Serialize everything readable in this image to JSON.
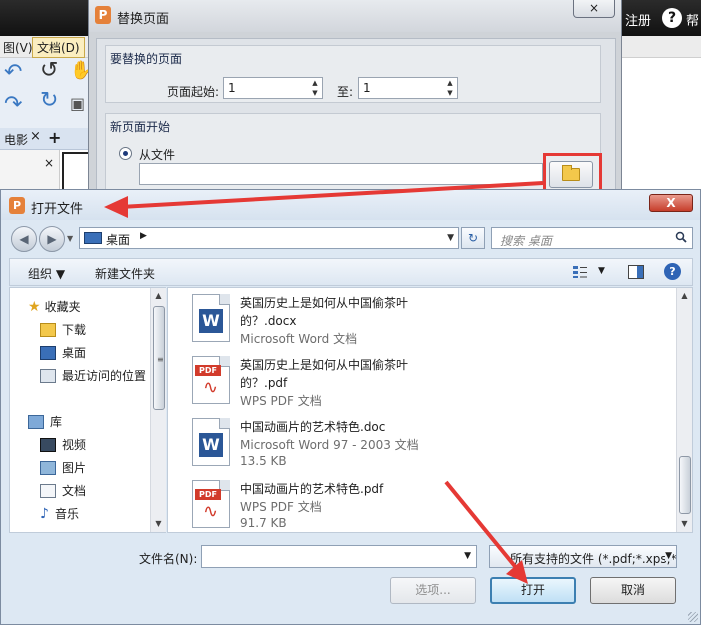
{
  "app": {
    "register": "注册",
    "help": "帮",
    "menu_view": "图(V)",
    "menu_doc": "文档(D)",
    "tab_label": "电影"
  },
  "replace_dialog": {
    "title": "替换页面",
    "close": "×",
    "group1_title": "要替换的页面",
    "page_start_label": "页面起始:",
    "page_start_value": "1",
    "to_label": "至:",
    "to_value": "1",
    "group2_title": "新页面开始",
    "from_file_label": "从文件",
    "file_path": ""
  },
  "open_dialog": {
    "title": "打开文件",
    "close": "X",
    "address": "桌面",
    "search_placeholder": "搜索 桌面",
    "toolbar": {
      "organize": "组织",
      "new_folder": "新建文件夹"
    },
    "nav": [
      {
        "label": "收藏夹",
        "icon": "star-icon"
      },
      {
        "label": "下载",
        "icon": "download-folder-icon"
      },
      {
        "label": "桌面",
        "icon": "desktop-icon"
      },
      {
        "label": "最近访问的位置",
        "icon": "recent-places-icon"
      },
      {
        "label": "库",
        "icon": "library-icon"
      },
      {
        "label": "视频",
        "icon": "video-icon"
      },
      {
        "label": "图片",
        "icon": "pictures-icon"
      },
      {
        "label": "文档",
        "icon": "documents-icon"
      },
      {
        "label": "音乐",
        "icon": "music-icon"
      }
    ],
    "files": [
      {
        "type": "word",
        "line1": "英国历史上是如何从中国偷茶叶",
        "line2": "的？.docx",
        "line3": "Microsoft Word 文档"
      },
      {
        "type": "pdf",
        "line1": "英国历史上是如何从中国偷茶叶",
        "line2": "的？.pdf",
        "line3": "WPS PDF 文档"
      },
      {
        "type": "word",
        "line1": "中国动画片的艺术特色.doc",
        "line2": "Microsoft Word 97 - 2003 文档",
        "line3": "13.5 KB"
      },
      {
        "type": "pdf",
        "line1": "中国动画片的艺术特色.pdf",
        "line2": "WPS PDF 文档",
        "line3": "91.7 KB"
      }
    ],
    "pdf_badge": "PDF",
    "word_badge": "W",
    "filename_label": "文件名(N):",
    "filename_value": "",
    "filetype_value": "所有支持的文件 (*.pdf;*.xps;*.e",
    "options_button": "选项...",
    "open_button": "打开",
    "cancel_button": "取消"
  },
  "colors": {
    "annotation_red": "#e53935",
    "accent_blue": "#3c7fb1"
  }
}
